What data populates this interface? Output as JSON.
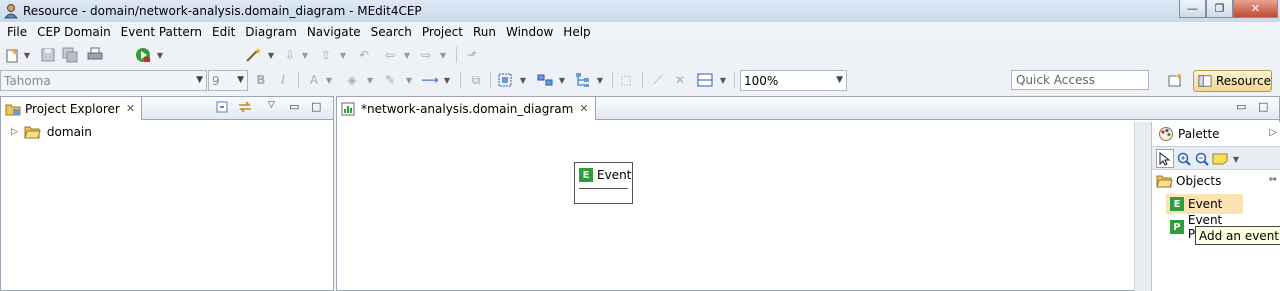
{
  "window": {
    "title": "Resource - domain/network-analysis.domain_diagram - MEdit4CEP",
    "minimize": "—",
    "maximize": "❐",
    "close": "✕"
  },
  "menu": [
    "File",
    "CEP Domain",
    "Event Pattern",
    "Edit",
    "Diagram",
    "Navigate",
    "Search",
    "Project",
    "Run",
    "Window",
    "Help"
  ],
  "toolbar": {
    "font_family": "Tahoma",
    "font_size": "9",
    "bold": "B",
    "italic": "I",
    "font_color": "A",
    "zoom": "100%",
    "quick_access_placeholder": "Quick Access",
    "perspective": "Resource"
  },
  "project_explorer": {
    "title": "Project Explorer",
    "tree": [
      {
        "label": "domain"
      }
    ]
  },
  "editor": {
    "tab": "*network-analysis.domain_diagram",
    "nodes": [
      {
        "type_badge": "E",
        "label": "Event"
      }
    ]
  },
  "palette": {
    "title": "Palette",
    "drawer": "Objects",
    "items": [
      {
        "badge": "E",
        "label": "Event"
      },
      {
        "badge": "P",
        "label": "Event Property"
      }
    ],
    "tooltip": "Add an event"
  },
  "colors": {
    "accent_green": "#2f9e3d",
    "selection": "#fbe3b3",
    "tooltip_bg": "#ffffe1"
  }
}
